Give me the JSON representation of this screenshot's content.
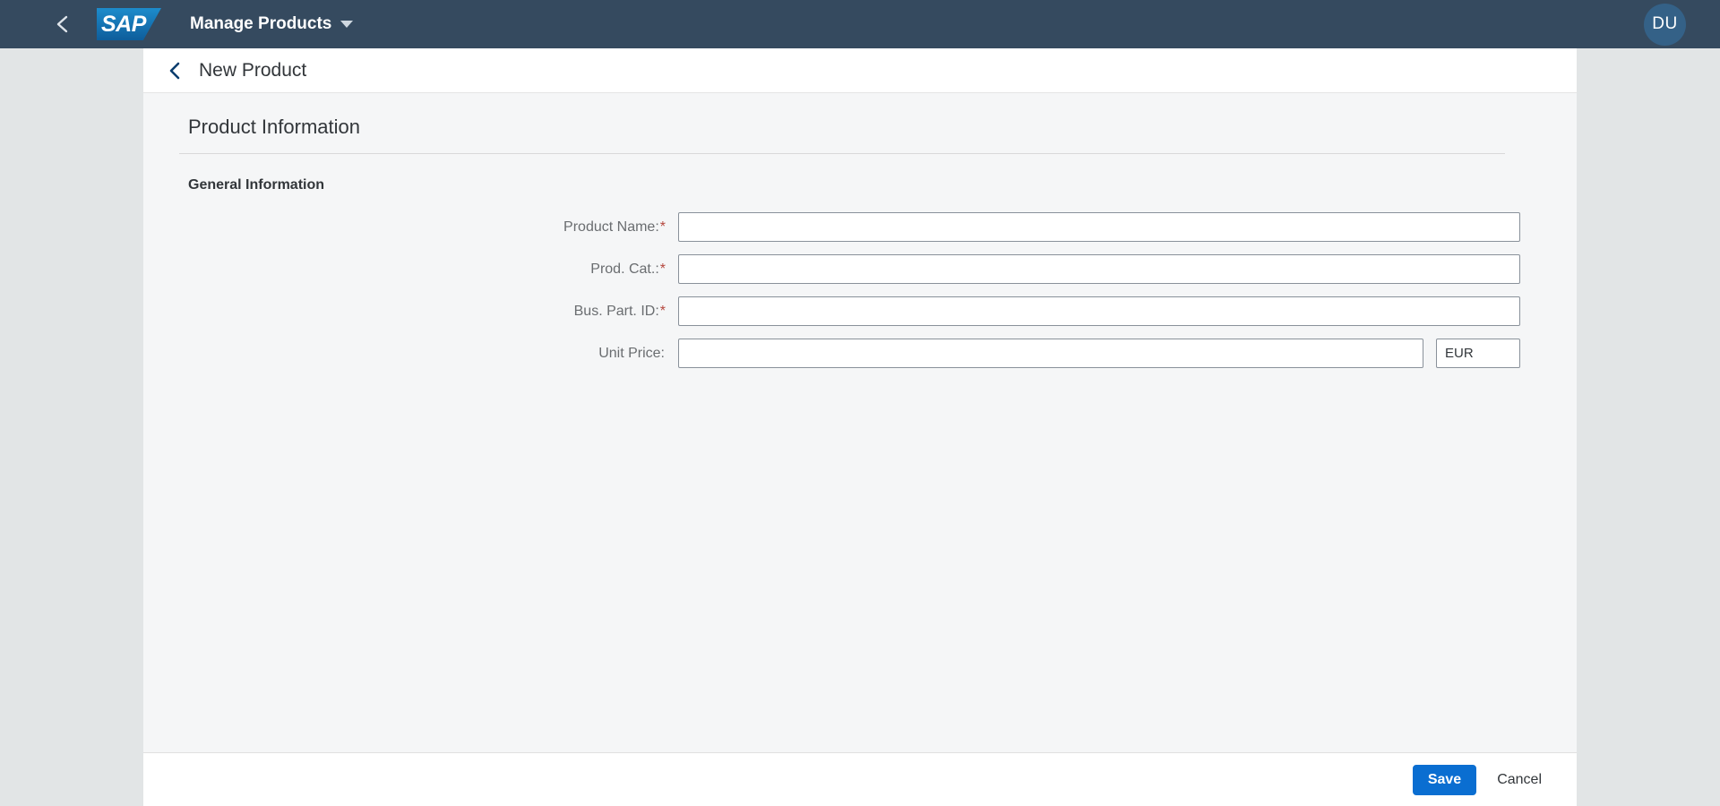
{
  "shellbar": {
    "back_icon": "chevron-left-icon",
    "logo_text": "SAP",
    "app_title": "Manage Products",
    "caret_icon": "chevron-down-icon",
    "avatar_initials": "DU",
    "bar_color": "#354a5f",
    "logo_color": "#0e5d9b",
    "avatar_color": "#346187"
  },
  "object_header": {
    "back_icon": "chevron-left-icon",
    "title": "New Product"
  },
  "content": {
    "section_title": "Product Information",
    "group_title": "General Information",
    "fields": [
      {
        "label": "Product Name:",
        "required": true,
        "required_mark": "*",
        "value": "",
        "placeholder": ""
      },
      {
        "label": "Prod. Cat.:",
        "required": true,
        "required_mark": "*",
        "value": "",
        "placeholder": ""
      },
      {
        "label": "Bus. Part. ID:",
        "required": true,
        "required_mark": "*",
        "value": "",
        "placeholder": ""
      },
      {
        "label": "Unit Price:",
        "required": false,
        "required_mark": "",
        "value": "",
        "placeholder": ""
      }
    ],
    "currency": {
      "value": "EUR",
      "placeholder": ""
    }
  },
  "footer": {
    "save_label": "Save",
    "cancel_label": "Cancel",
    "save_color": "#0a6ed1"
  }
}
